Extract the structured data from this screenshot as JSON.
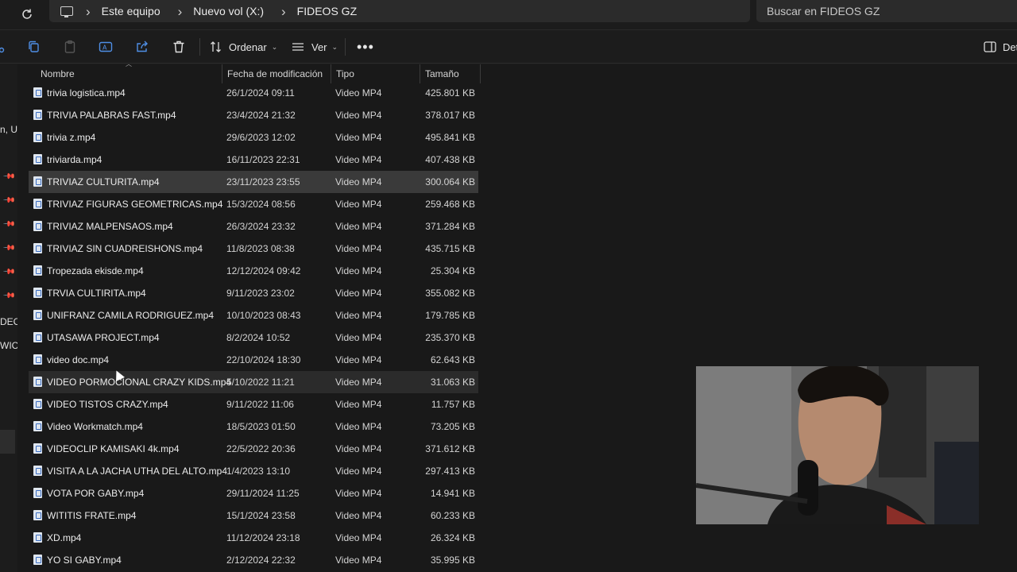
{
  "address": {
    "crumbs": [
      "Este equipo",
      "Nuevo vol (X:)",
      "FIDEOS GZ"
    ],
    "search_placeholder": "Buscar en FIDEOS GZ"
  },
  "toolbar": {
    "sort_label": "Ordenar",
    "view_label": "Ver",
    "details_label": "Det"
  },
  "nav": {
    "fragments": [
      "n, U",
      "DEC",
      "WIC"
    ]
  },
  "columns": {
    "name": "Nombre",
    "date": "Fecha de modificación",
    "type": "Tipo",
    "size": "Tamaño"
  },
  "files": [
    {
      "name": "trivia logistica.mp4",
      "date": "26/1/2024 09:11",
      "type": "Video MP4",
      "size": "425.801 KB"
    },
    {
      "name": "TRIVIA PALABRAS FAST.mp4",
      "date": "23/4/2024 21:32",
      "type": "Video MP4",
      "size": "378.017 KB"
    },
    {
      "name": "trivia z.mp4",
      "date": "29/6/2023 12:02",
      "type": "Video MP4",
      "size": "495.841 KB"
    },
    {
      "name": "triviarda.mp4",
      "date": "16/11/2023 22:31",
      "type": "Video MP4",
      "size": "407.438 KB"
    },
    {
      "name": "TRIVIAZ CULTURITA.mp4",
      "date": "23/11/2023 23:55",
      "type": "Video MP4",
      "size": "300.064 KB"
    },
    {
      "name": "TRIVIAZ FIGURAS GEOMETRICAS.mp4",
      "date": "15/3/2024 08:56",
      "type": "Video MP4",
      "size": "259.468 KB"
    },
    {
      "name": "TRIVIAZ MALPENSAOS.mp4",
      "date": "26/3/2024 23:32",
      "type": "Video MP4",
      "size": "371.284 KB"
    },
    {
      "name": "TRIVIAZ SIN CUADREISHONS.mp4",
      "date": "11/8/2023 08:38",
      "type": "Video MP4",
      "size": "435.715 KB"
    },
    {
      "name": "Tropezada ekisde.mp4",
      "date": "12/12/2024 09:42",
      "type": "Video MP4",
      "size": "25.304 KB"
    },
    {
      "name": "TRVIA CULTIRITA.mp4",
      "date": "9/11/2023 23:02",
      "type": "Video MP4",
      "size": "355.082 KB"
    },
    {
      "name": "UNIFRANZ CAMILA RODRIGUEZ.mp4",
      "date": "10/10/2023 08:43",
      "type": "Video MP4",
      "size": "179.785 KB"
    },
    {
      "name": "UTASAWA PROJECT.mp4",
      "date": "8/2/2024 10:52",
      "type": "Video MP4",
      "size": "235.370 KB"
    },
    {
      "name": "video doc.mp4",
      "date": "22/10/2024 18:30",
      "type": "Video MP4",
      "size": "62.643 KB"
    },
    {
      "name": "VIDEO PORMOCIONAL CRAZY KIDS.mp4",
      "date": "5/10/2022 11:21",
      "type": "Video MP4",
      "size": "31.063 KB"
    },
    {
      "name": "VIDEO TISTOS CRAZY.mp4",
      "date": "9/11/2022 11:06",
      "type": "Video MP4",
      "size": "11.757 KB"
    },
    {
      "name": "Video Workmatch.mp4",
      "date": "18/5/2023 01:50",
      "type": "Video MP4",
      "size": "73.205 KB"
    },
    {
      "name": "VIDEOCLIP KAMISAKI 4k.mp4",
      "date": "22/5/2022 20:36",
      "type": "Video MP4",
      "size": "371.612 KB"
    },
    {
      "name": "VISITA A LA JACHA UTHA DEL ALTO.mp4",
      "date": "1/4/2023 13:10",
      "type": "Video MP4",
      "size": "297.413 KB"
    },
    {
      "name": "VOTA POR GABY.mp4",
      "date": "29/11/2024 11:25",
      "type": "Video MP4",
      "size": "14.941 KB"
    },
    {
      "name": "WITITIS FRATE.mp4",
      "date": "15/1/2024 23:58",
      "type": "Video MP4",
      "size": "60.233 KB"
    },
    {
      "name": "XD.mp4",
      "date": "11/12/2024 23:18",
      "type": "Video MP4",
      "size": "26.324 KB"
    },
    {
      "name": "YO SI GABY.mp4",
      "date": "2/12/2024 22:32",
      "type": "Video MP4",
      "size": "35.995 KB"
    }
  ],
  "selected_file": "TRIVIAZ CULTURITA.mp4",
  "hovered_file": "VIDEO PORMOCIONAL CRAZY KIDS.mp4"
}
